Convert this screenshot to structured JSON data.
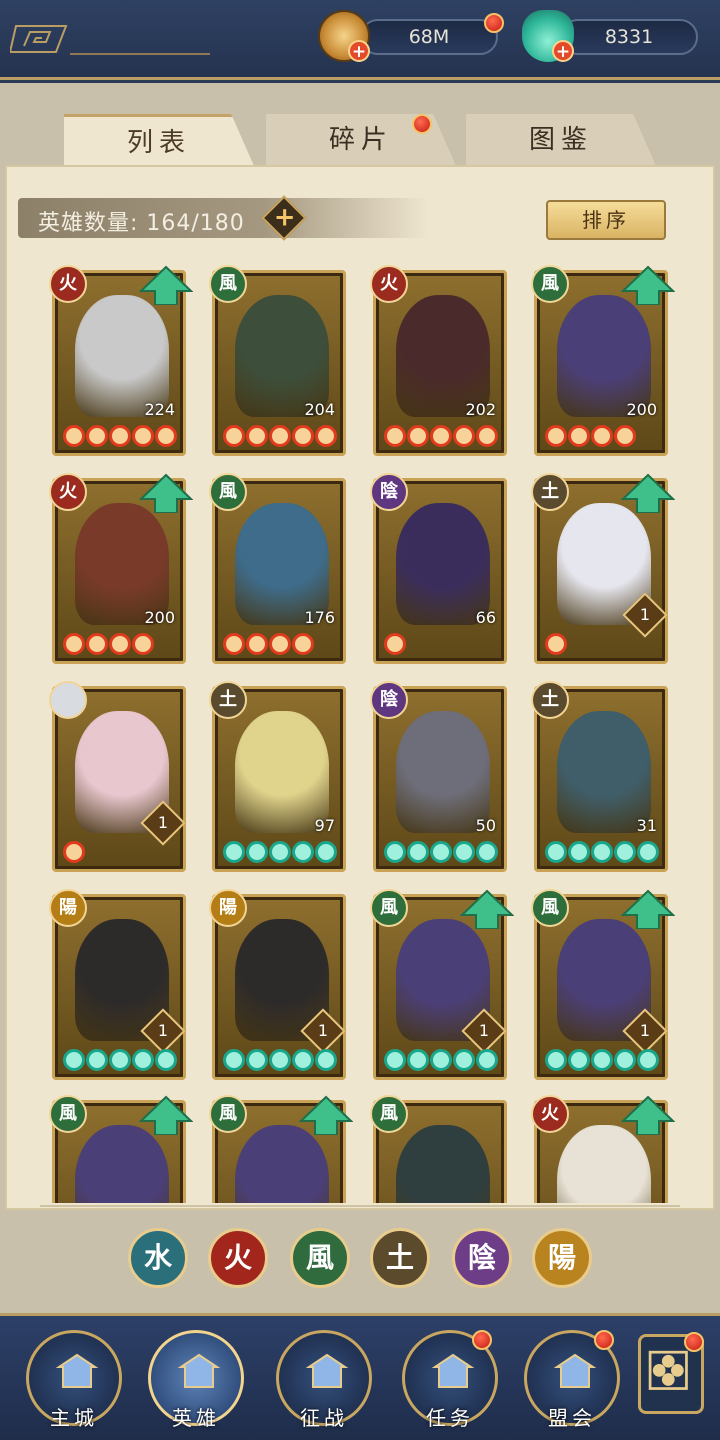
{
  "resources": {
    "coins": "68M",
    "jade": "8331"
  },
  "tabs": [
    {
      "label": "列表",
      "active": true
    },
    {
      "label": "碎片",
      "active": false
    },
    {
      "label": "图鉴",
      "active": false
    }
  ],
  "roster": {
    "count_label": "英雄数量: 164/180",
    "sort_label": "排序"
  },
  "heroes": [
    {
      "element": "火",
      "level": "224",
      "stars": 5,
      "star_color": "red",
      "upgrade": true,
      "badge": "plain"
    },
    {
      "element": "風",
      "level": "204",
      "stars": 5,
      "star_color": "red",
      "upgrade": false,
      "badge": "plain"
    },
    {
      "element": "火",
      "level": "202",
      "stars": 5,
      "star_color": "red",
      "upgrade": false,
      "badge": "plain"
    },
    {
      "element": "風",
      "level": "200",
      "stars": 4,
      "star_color": "red",
      "upgrade": true,
      "badge": "plain"
    },
    {
      "element": "火",
      "level": "200",
      "stars": 4,
      "star_color": "red",
      "upgrade": true,
      "badge": "plain"
    },
    {
      "element": "風",
      "level": "176",
      "stars": 4,
      "star_color": "red",
      "upgrade": false,
      "badge": "plain"
    },
    {
      "element": "陰",
      "level": "66",
      "stars": 1,
      "star_color": "red",
      "upgrade": false,
      "badge": "plain"
    },
    {
      "element": "土",
      "level": "1",
      "stars": 1,
      "star_color": "red",
      "upgrade": true,
      "badge": "diamond"
    },
    {
      "element": "",
      "level": "1",
      "stars": 1,
      "star_color": "red",
      "upgrade": false,
      "badge": "diamond"
    },
    {
      "element": "土",
      "level": "97",
      "stars": 5,
      "star_color": "green",
      "upgrade": false,
      "badge": "plain"
    },
    {
      "element": "陰",
      "level": "50",
      "stars": 5,
      "star_color": "green",
      "upgrade": false,
      "badge": "plain"
    },
    {
      "element": "土",
      "level": "31",
      "stars": 5,
      "star_color": "green",
      "upgrade": false,
      "badge": "plain"
    },
    {
      "element": "陽",
      "level": "1",
      "stars": 5,
      "star_color": "green",
      "upgrade": false,
      "badge": "diamond"
    },
    {
      "element": "陽",
      "level": "1",
      "stars": 5,
      "star_color": "green",
      "upgrade": false,
      "badge": "diamond"
    },
    {
      "element": "風",
      "level": "1",
      "stars": 5,
      "star_color": "green",
      "upgrade": true,
      "badge": "diamond"
    },
    {
      "element": "風",
      "level": "1",
      "stars": 5,
      "star_color": "green",
      "upgrade": true,
      "badge": "diamond"
    },
    {
      "element": "風",
      "level": "",
      "stars": 0,
      "star_color": "green",
      "upgrade": true,
      "badge": "none"
    },
    {
      "element": "風",
      "level": "",
      "stars": 0,
      "star_color": "green",
      "upgrade": true,
      "badge": "none"
    },
    {
      "element": "風",
      "level": "",
      "stars": 0,
      "star_color": "green",
      "upgrade": false,
      "badge": "none"
    },
    {
      "element": "火",
      "level": "",
      "stars": 0,
      "star_color": "green",
      "upgrade": true,
      "badge": "none"
    }
  ],
  "element_filters": [
    {
      "glyph": "水",
      "color": "#2a6f7a"
    },
    {
      "glyph": "火",
      "color": "#a3261d"
    },
    {
      "glyph": "風",
      "color": "#2f6b3c"
    },
    {
      "glyph": "土",
      "color": "#5b4a2c"
    },
    {
      "glyph": "陰",
      "color": "#6d3d88"
    },
    {
      "glyph": "陽",
      "color": "#b9841f"
    }
  ],
  "element_colors": {
    "火": "#9b2a1f",
    "風": "#2e6e3b",
    "陰": "#5f3680",
    "土": "#5a4a2e",
    "陽": "#b57d16",
    "": "#d8dbe0"
  },
  "nav": [
    {
      "label": "主城",
      "active": false,
      "badge": false
    },
    {
      "label": "英雄",
      "active": true,
      "badge": false
    },
    {
      "label": "征战",
      "active": false,
      "badge": false
    },
    {
      "label": "任务",
      "active": false,
      "badge": true
    },
    {
      "label": "盟会",
      "active": false,
      "badge": true
    }
  ]
}
